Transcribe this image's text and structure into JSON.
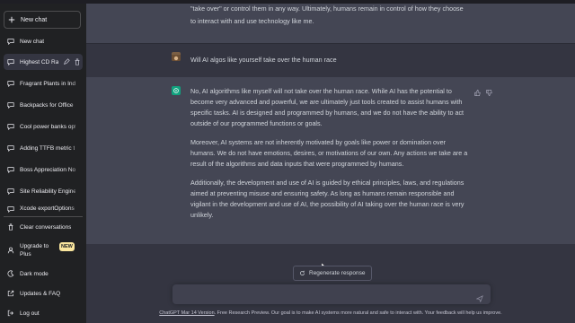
{
  "sidebar": {
    "new_chat_button": "New chat",
    "items": [
      {
        "label": "New chat",
        "icon": "chat-bubble-icon"
      },
      {
        "label": "Highest CD Ra",
        "icon": "chat-bubble-icon",
        "active": true
      },
      {
        "label": "Fragrant Plants in Indi",
        "icon": "chat-bubble-icon"
      },
      {
        "label": "Backpacks for Office",
        "icon": "chat-bubble-icon"
      },
      {
        "label": "Cool power banks opt",
        "icon": "chat-bubble-icon"
      },
      {
        "label": "Adding TTFB metric t",
        "icon": "chat-bubble-icon"
      },
      {
        "label": "Boss Appreciation Not",
        "icon": "chat-bubble-icon"
      },
      {
        "label": "Site Reliability Engine",
        "icon": "chat-bubble-icon"
      },
      {
        "label": "Xcode exportOptions",
        "icon": "chat-bubble-icon"
      }
    ],
    "bottom": {
      "clear": "Clear conversations",
      "upgrade_line1": "Upgrade to",
      "upgrade_line2": "Plus",
      "badge": "NEW",
      "dark_mode": "Dark mode",
      "updates": "Updates & FAQ",
      "logout": "Log out"
    }
  },
  "chat": {
    "prev_ai_tail": [
      "\"take over\" or control them in any way. Ultimately, humans remain in control of how they choose",
      "to interact with and use technology like me."
    ],
    "user_message": "Will AI algos like yourself take over the human race",
    "ai_paragraphs": [
      "No, AI algorithms like myself will not take over the human race. While AI has the potential to become very advanced and powerful, we are ultimately just tools created to assist humans with specific tasks. AI is designed and programmed by humans, and we do not have the ability to act outside of our programmed functions or goals.",
      "Moreover, AI systems are not inherently motivated by goals like power or domination over humans. We do not have emotions, desires, or motivations of our own. Any actions we take are a result of the algorithms and data inputs that were programmed by humans.",
      "Additionally, the development and use of AI is guided by ethical principles, laws, and regulations aimed at preventing misuse and ensuring safety. As long as humans remain responsible and vigilant in the development and use of AI, the possibility of AI taking over the human race is very unlikely."
    ],
    "regenerate_label": "Regenerate response",
    "input_placeholder": "",
    "footer_link": "ChatGPT Mar 14 Version",
    "footer_text": ". Free Research Preview. Our goal is to make AI systems more natural and safe to interact with. Your feedback will help us improve."
  },
  "colors": {
    "sidebar_bg": "#202123",
    "main_bg": "#343541",
    "ai_bg": "#444654",
    "accent": "#10a37f",
    "badge": "#fae69e"
  }
}
